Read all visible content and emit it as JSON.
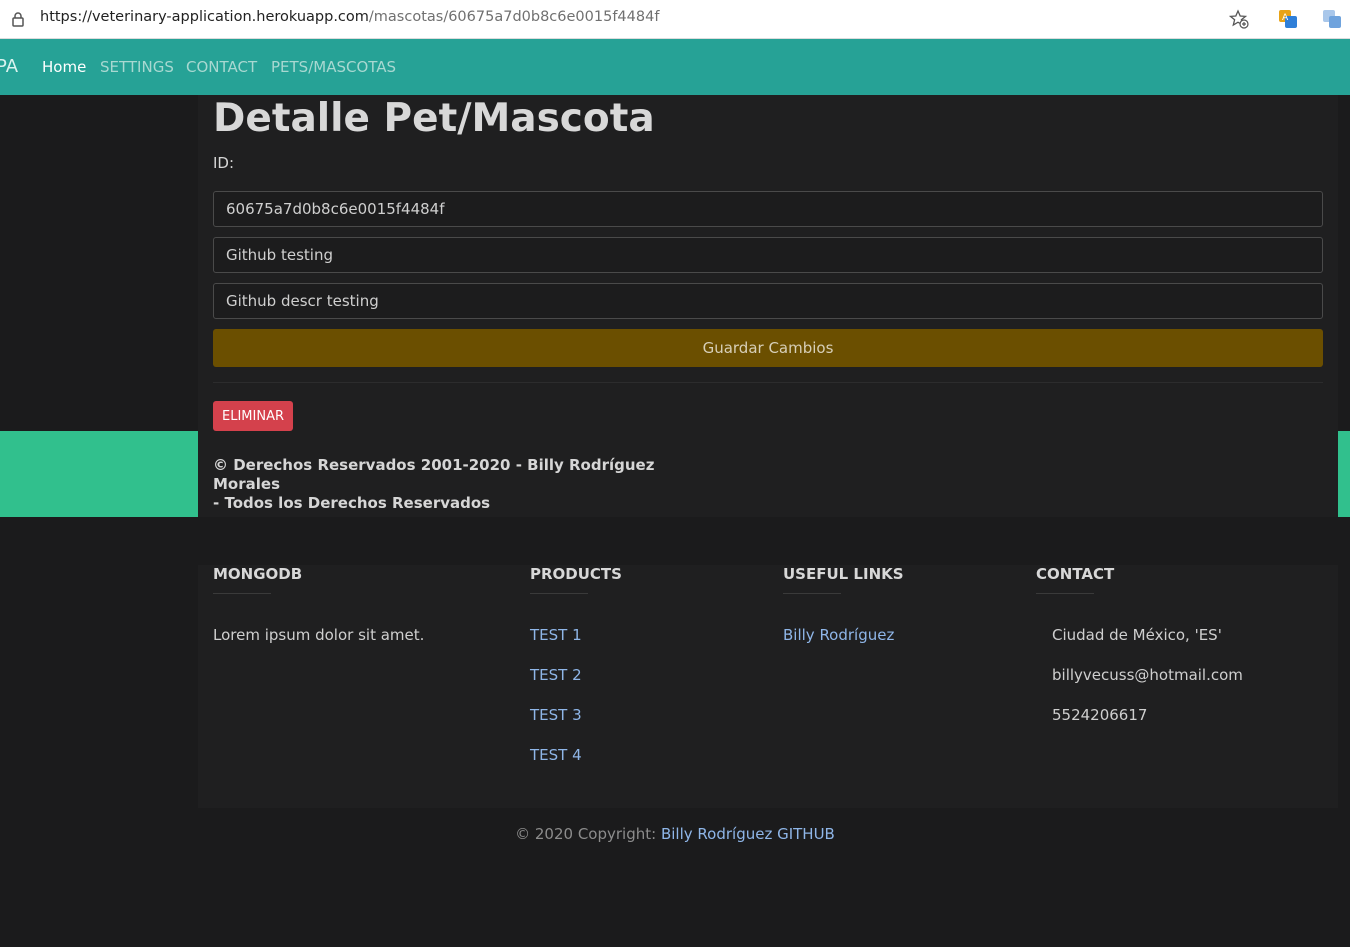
{
  "browser": {
    "url_host": "https://veterinary-application.herokuapp.com",
    "url_path": "/mascotas/60675a7d0b8c6e0015f4484f"
  },
  "navbar": {
    "brand": "PA",
    "links": [
      "Home",
      "SETTINGS",
      "CONTACT",
      "PETS/MASCOTAS"
    ]
  },
  "page": {
    "title": "Detalle Pet/Mascota",
    "id_label": "ID:",
    "fields": {
      "id_value": "60675a7d0b8c6e0015f4484f",
      "name_value": "Github testing",
      "description_value": "Github descr testing"
    },
    "save_label": "Guardar Cambios",
    "delete_label": "ELIMINAR",
    "copyright_line1": "© Derechos Reservados 2001-2020 - Billy Rodríguez Morales",
    "copyright_line2": "- Todos los Derechos Reservados"
  },
  "footer": {
    "mongodb": {
      "heading": "MONGODB",
      "text": "Lorem ipsum dolor sit amet."
    },
    "products": {
      "heading": "PRODUCTS",
      "links": [
        "TEST 1",
        "TEST 2",
        "TEST 3",
        "TEST 4"
      ]
    },
    "useful_links": {
      "heading": "USEFUL LINKS",
      "links": [
        "Billy Rodríguez"
      ]
    },
    "contact": {
      "heading": "CONTACT",
      "address": "Ciudad de México, 'ES'",
      "email": "billyvecuss@hotmail.com",
      "phone": "5524206617"
    },
    "copyright_prefix": "© 2020 Copyright:",
    "copyright_link": "Billy Rodríguez GITHUB"
  },
  "colors": {
    "navbar": "#26a296",
    "accent_green": "#31c08d",
    "save_button": "#6b4f00",
    "delete_button": "#d4414c",
    "link": "#8fb6e8"
  },
  "icons": [
    "lock-icon",
    "favorites-star-icon",
    "extension-translate-icon",
    "extension-icon"
  ]
}
